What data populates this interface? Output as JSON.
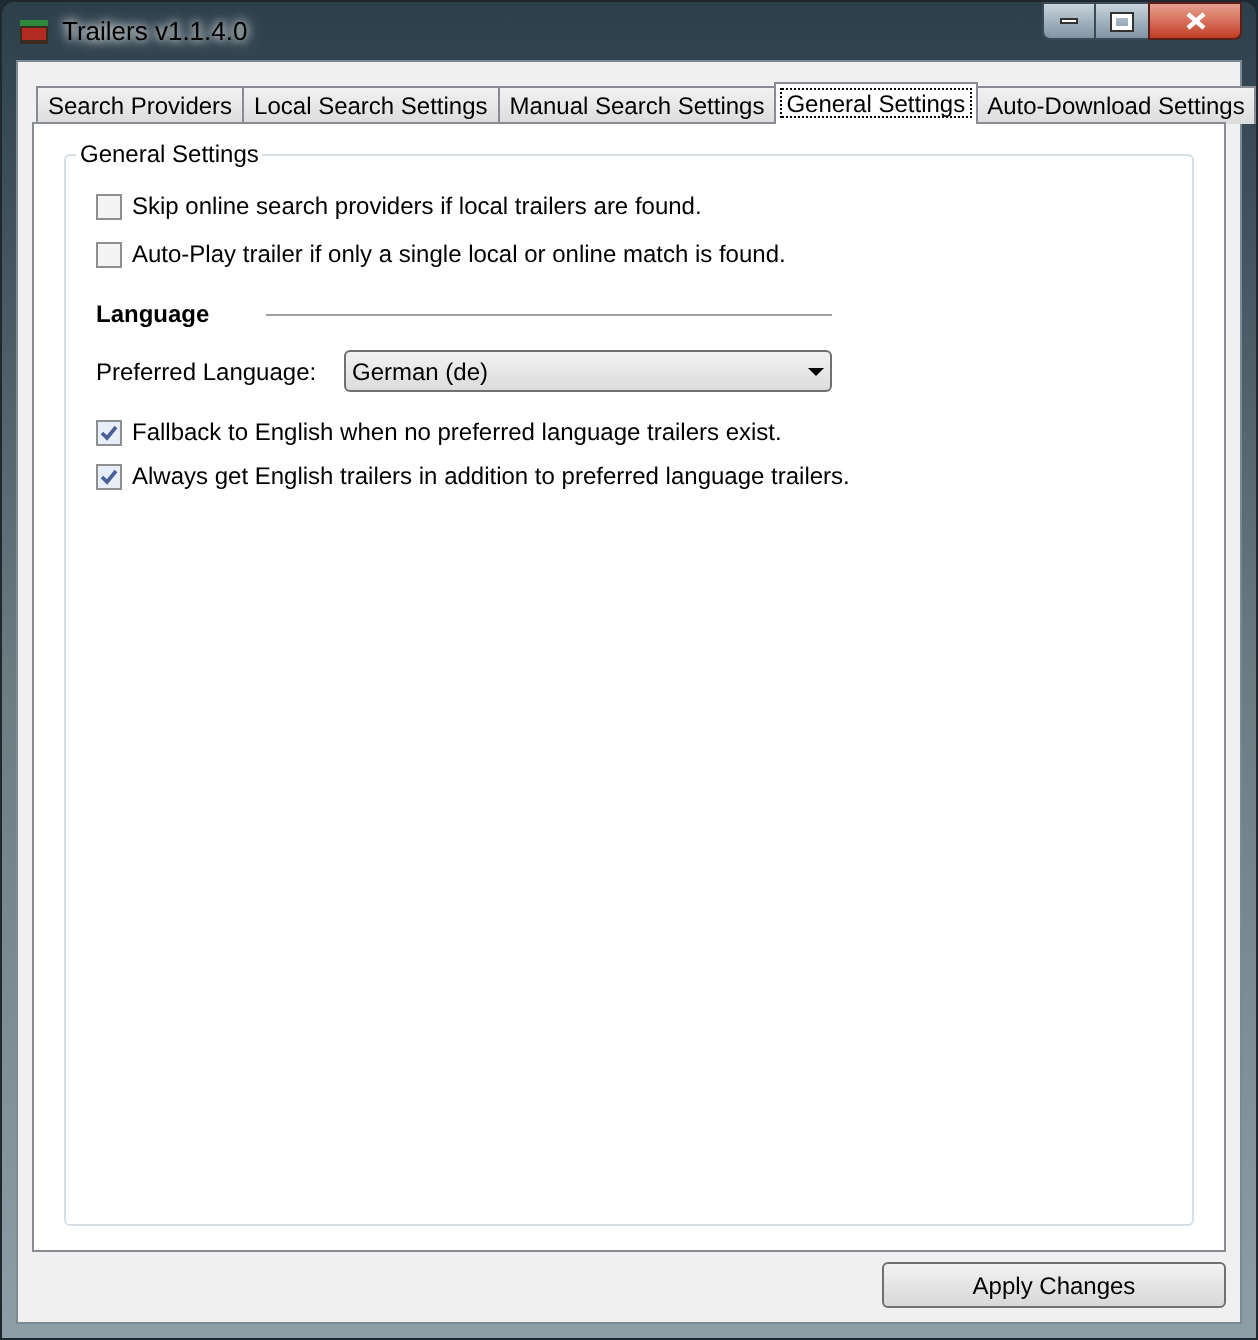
{
  "window": {
    "title": "Trailers v1.1.4.0"
  },
  "tabs": [
    {
      "label": "Search Providers",
      "selected": false
    },
    {
      "label": "Local Search Settings",
      "selected": false
    },
    {
      "label": "Manual Search Settings",
      "selected": false
    },
    {
      "label": "General Settings",
      "selected": true
    },
    {
      "label": "Auto-Download Settings",
      "selected": false
    }
  ],
  "group": {
    "title": "General Settings",
    "options": [
      {
        "label": "Skip online search providers if local trailers are found.",
        "checked": false
      },
      {
        "label": "Auto-Play trailer if only a single local or online match is found.",
        "checked": false
      }
    ],
    "language_section": {
      "heading": "Language",
      "preferred_label": "Preferred Language:",
      "preferred_value": "German (de)",
      "options": [
        {
          "label": "Fallback to English when no preferred language trailers exist.",
          "checked": true
        },
        {
          "label": "Always get English trailers in addition to preferred language trailers.",
          "checked": true
        }
      ]
    }
  },
  "apply_button": "Apply Changes"
}
